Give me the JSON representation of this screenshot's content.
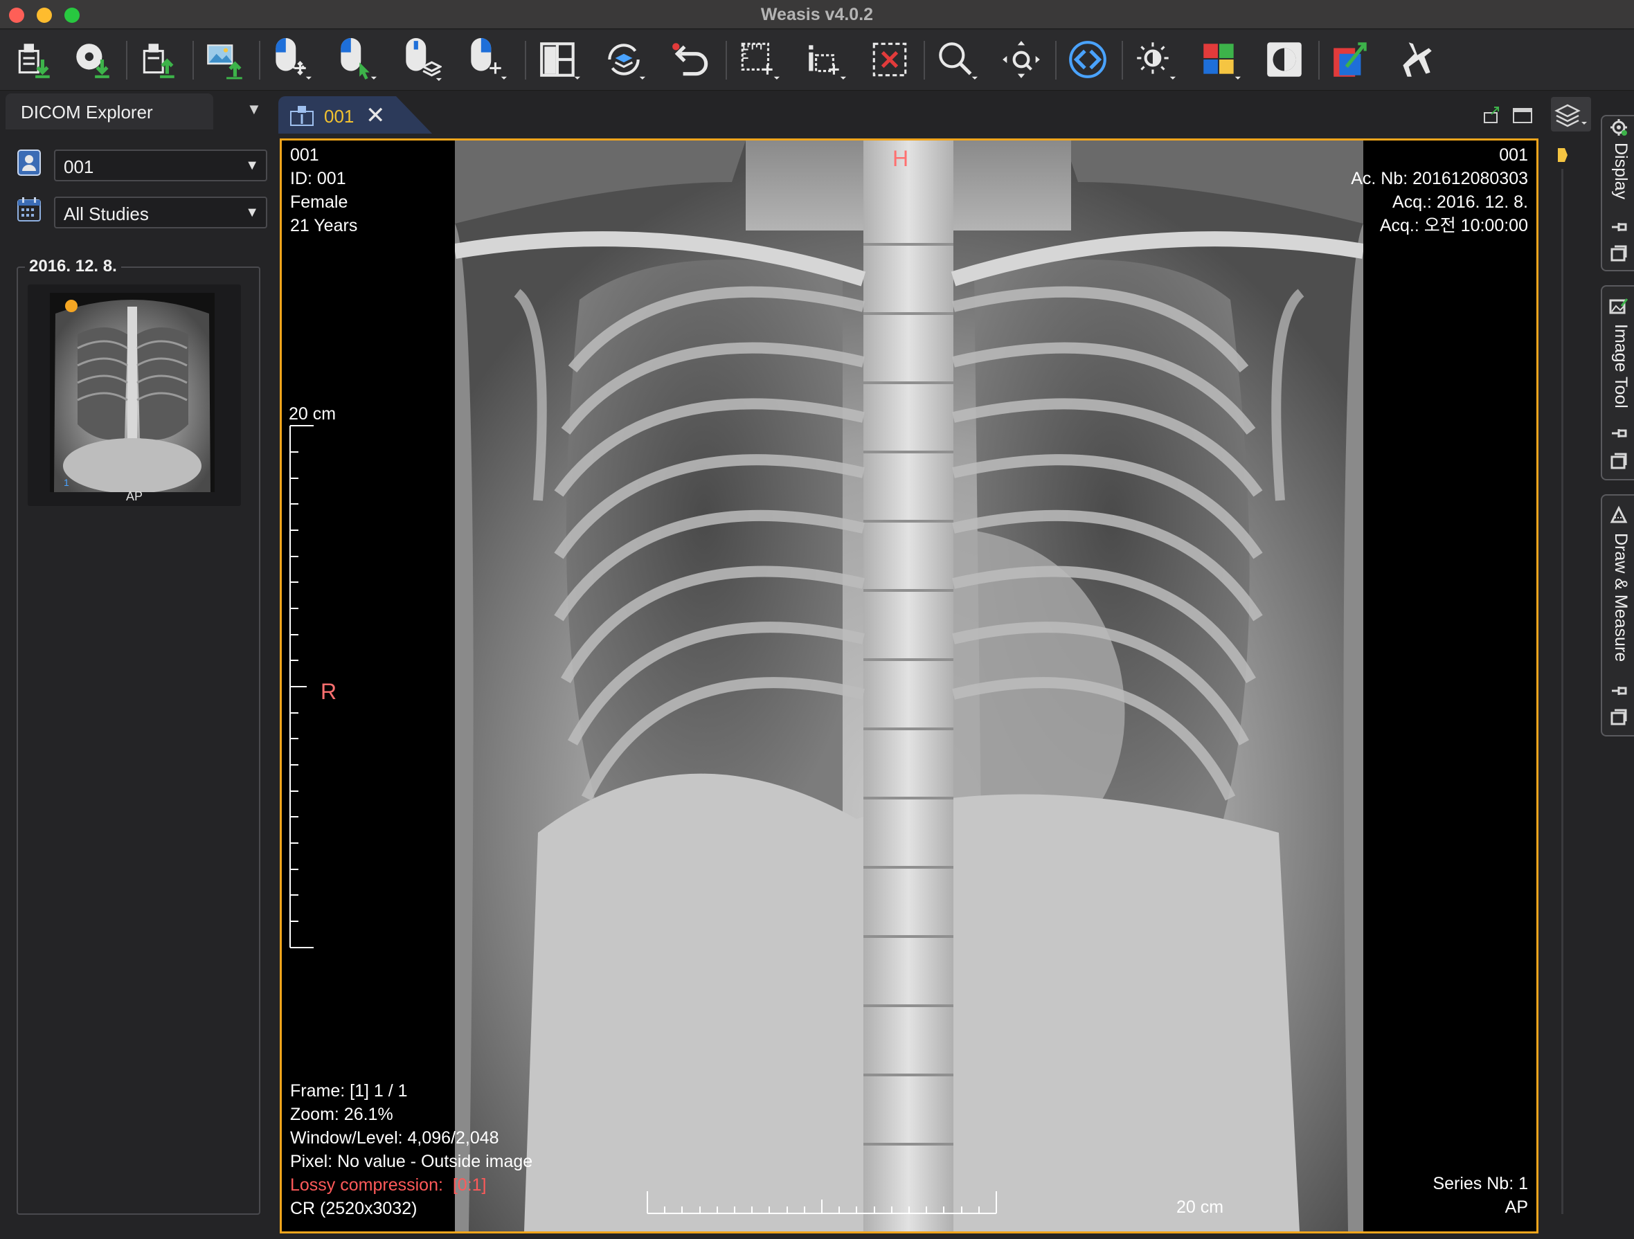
{
  "window": {
    "title": "Weasis v4.0.2"
  },
  "toolbar": {
    "buttons": [
      "import-dicom-icon",
      "import-cd-icon",
      "export-dicom-icon",
      "export-image-icon",
      "mouse-left-pan-icon",
      "mouse-select-icon",
      "mouse-middle-scroll-icon",
      "mouse-right-pan-icon",
      "layout-icon",
      "synch-icon",
      "reset-icon",
      "measure-ruler-icon",
      "crosshair-icon",
      "clear-selection-icon",
      "zoom-icon",
      "magnifier-icon",
      "navigation-icon",
      "window-level-icon",
      "color-lut-icon",
      "invert-icon",
      "rotate-flip-icon",
      "cine-icon"
    ]
  },
  "explorer": {
    "tab_label": "DICOM Explorer",
    "patient_value": "001",
    "studies_value": "All Studies",
    "study_date": "2016. 12. 8.",
    "thumbnail": {
      "series_label": "AP",
      "series_number": "1",
      "status_color": "#f5a623"
    }
  },
  "viewer": {
    "tab_label": "001",
    "accent_color": "#f2a51c",
    "overlay": {
      "top_left": [
        "001",
        "ID: 001",
        "Female",
        "21 Years"
      ],
      "top_right": [
        "001",
        "Ac. Nb: 201612080303",
        "Acq.: 2016. 12. 8.",
        "Acq.: 오전 10:00:00"
      ],
      "bottom_left": [
        "Frame: [1] 1 / 1",
        "Zoom: 26.1%",
        "Window/Level: 4,096/2,048",
        "Pixel: No value - Outside image"
      ],
      "lossy_label": "Lossy compression:",
      "lossy_value": "[0:1]",
      "modality_size": "CR (2520x3032)",
      "bottom_right": [
        "Series Nb: 1",
        "AP"
      ],
      "scale_vertical": "20 cm",
      "scale_horizontal": "20 cm",
      "orientation_top": "H",
      "orientation_left": "R"
    }
  },
  "right_panel": {
    "tabs": [
      "Display",
      "Image Tool",
      "Draw & Measure"
    ]
  }
}
